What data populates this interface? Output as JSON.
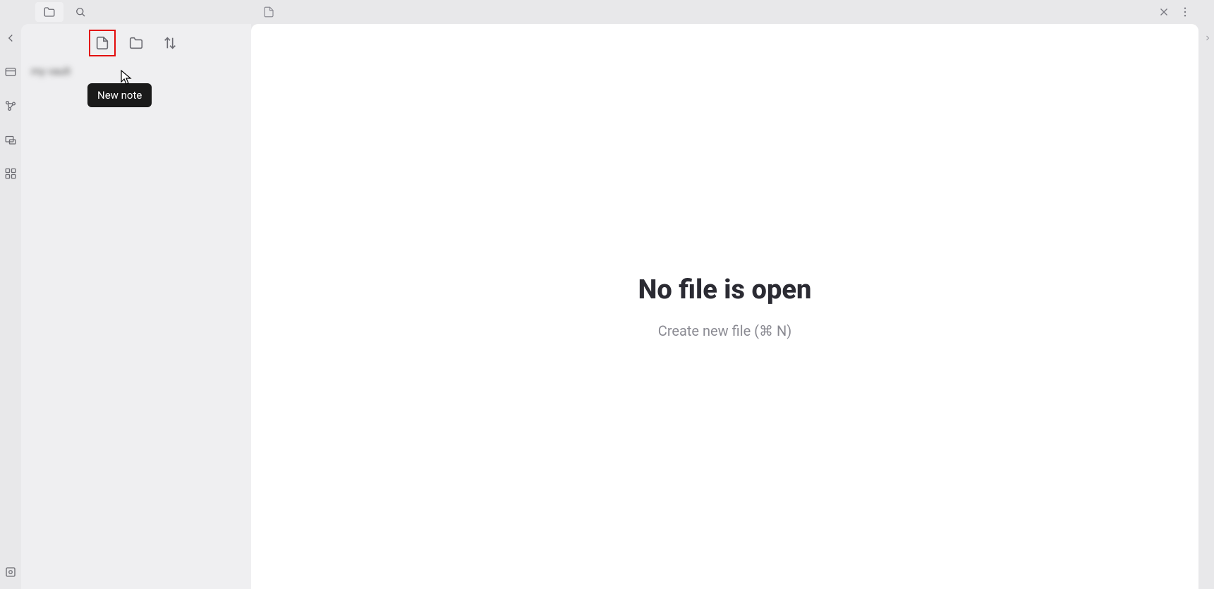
{
  "ribbon": {
    "items": [
      {
        "name": "collapse-left-icon"
      },
      {
        "name": "quick-switcher-icon"
      },
      {
        "name": "graph-view-icon"
      },
      {
        "name": "canvas-icon"
      },
      {
        "name": "command-palette-icon"
      }
    ],
    "bottom": {
      "name": "vault-icon"
    }
  },
  "explorer": {
    "tabs": {
      "files_active": true
    },
    "actions": {
      "new_note_tooltip": "New note"
    },
    "vault_label": "my vault"
  },
  "editor": {
    "empty_title": "No file is open",
    "empty_action": "Create new file (⌘ N)"
  }
}
